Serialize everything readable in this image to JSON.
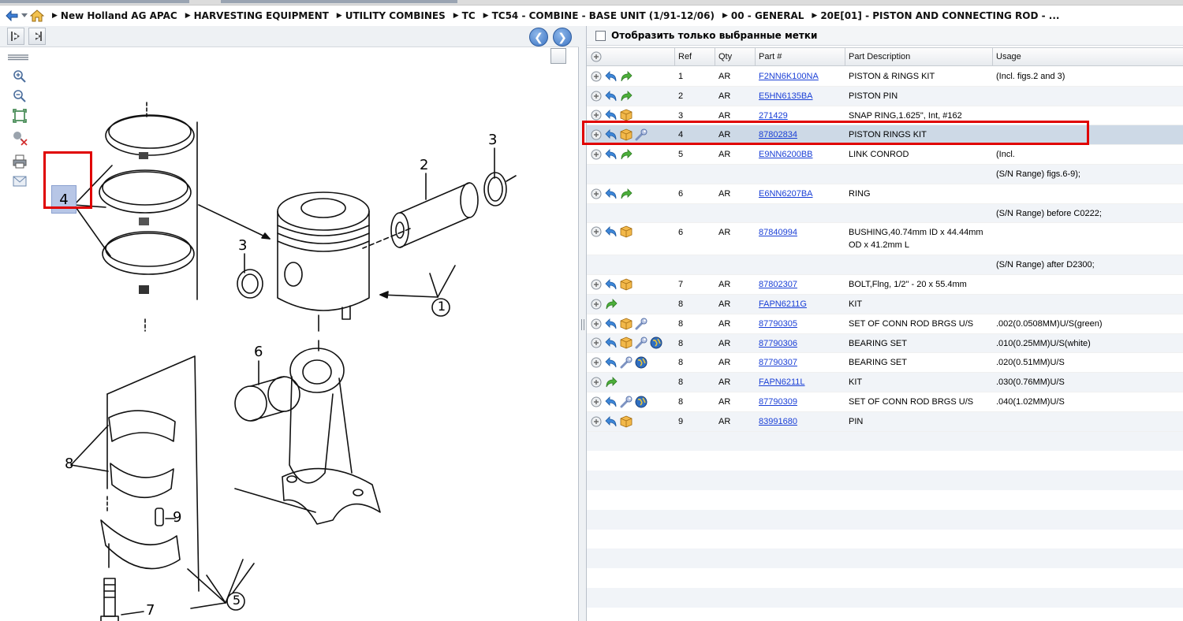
{
  "breadcrumb": {
    "items": [
      "New Holland AG APAC",
      "HARVESTING EQUIPMENT",
      "UTILITY COMBINES",
      "TC",
      "TC54 - COMBINE - BASE UNIT (1/91-12/06)",
      "00 - GENERAL",
      "20E[01] - PISTON AND CONNECTING ROD - ..."
    ]
  },
  "filter": {
    "label": "Отобразить только выбранные метки"
  },
  "table": {
    "headers": {
      "ref": "Ref",
      "qty": "Qty",
      "part": "Part #",
      "desc": "Part Description",
      "usage": "Usage"
    },
    "rows": [
      {
        "ref": "1",
        "qty": "AR",
        "part": "F2NN6K100NA",
        "desc": "PISTON & RINGS KIT",
        "usage": "(Incl. figs.2 and 3)"
      },
      {
        "ref": "2",
        "qty": "AR",
        "part": "E5HN6135BA",
        "desc": "PISTON PIN",
        "usage": ""
      },
      {
        "ref": "3",
        "qty": "AR",
        "part": "271429",
        "desc": "SNAP RING,1.625\", Int, #162",
        "usage": ""
      },
      {
        "ref": "4",
        "qty": "AR",
        "part": "87802834",
        "desc": "PISTON RINGS KIT",
        "usage": ""
      },
      {
        "ref": "5",
        "qty": "AR",
        "part": "E9NN6200BB",
        "desc": "LINK CONROD",
        "usage": "(Incl."
      },
      {
        "ref": "",
        "qty": "",
        "part": "",
        "desc": "",
        "usage": "(S/N Range) figs.6-9);"
      },
      {
        "ref": "6",
        "qty": "AR",
        "part": "E6NN6207BA",
        "desc": "RING",
        "usage": ""
      },
      {
        "ref": "",
        "qty": "",
        "part": "",
        "desc": "",
        "usage": "(S/N Range) before C0222;"
      },
      {
        "ref": "6",
        "qty": "AR",
        "part": "87840994",
        "desc": "BUSHING,40.74mm ID x 44.44mm OD x 41.2mm L",
        "usage": ""
      },
      {
        "ref": "",
        "qty": "",
        "part": "",
        "desc": "",
        "usage": "(S/N Range) after D2300;"
      },
      {
        "ref": "7",
        "qty": "AR",
        "part": "87802307",
        "desc": "BOLT,Flng, 1/2\" - 20 x 55.4mm",
        "usage": ""
      },
      {
        "ref": "8",
        "qty": "AR",
        "part": "FAPN6211G",
        "desc": "KIT",
        "usage": ""
      },
      {
        "ref": "8",
        "qty": "AR",
        "part": "87790305",
        "desc": "SET OF CONN ROD BRGS U/S",
        "usage": ".002(0.0508MM)U/S(green)"
      },
      {
        "ref": "8",
        "qty": "AR",
        "part": "87790306",
        "desc": "BEARING SET",
        "usage": ".010(0.25MM)U/S(white)"
      },
      {
        "ref": "8",
        "qty": "AR",
        "part": "87790307",
        "desc": "BEARING SET",
        "usage": ".020(0.51MM)U/S"
      },
      {
        "ref": "8",
        "qty": "AR",
        "part": "FAPN6211L",
        "desc": "KIT",
        "usage": ".030(0.76MM)U/S"
      },
      {
        "ref": "8",
        "qty": "AR",
        "part": "87790309",
        "desc": "SET OF CONN ROD BRGS U/S",
        "usage": ".040(1.02MM)U/S"
      },
      {
        "ref": "9",
        "qty": "AR",
        "part": "83991680",
        "desc": "PIN",
        "usage": ""
      }
    ]
  },
  "diagram": {
    "callouts": [
      "4",
      "2",
      "3",
      "3",
      "1",
      "6",
      "8",
      "9",
      "5",
      "7"
    ]
  },
  "colors": {
    "selection": "#cdd9e6",
    "highlight_border": "#e00000",
    "link": "#1a3fd6"
  }
}
